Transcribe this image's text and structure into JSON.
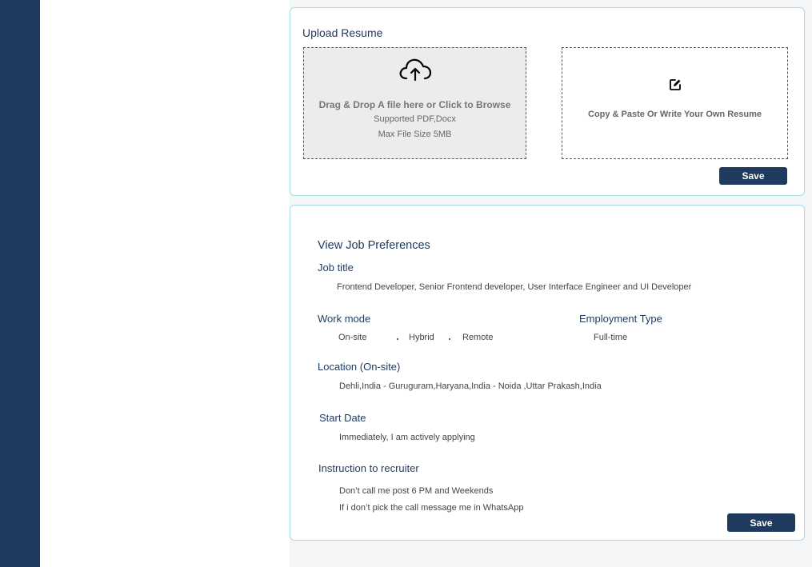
{
  "upload_resume": {
    "title": "Upload Resume",
    "dropzone": {
      "icon": "cloud-upload-icon",
      "main_text": "Drag & Drop A file here or Click to Browse",
      "supported_text": "Supported PDF,Docx",
      "max_size_text": "Max File Size 5MB"
    },
    "write_box": {
      "icon": "edit-icon",
      "text": "Copy & Paste Or Write Your Own Resume"
    },
    "save_label": "Save"
  },
  "job_preferences": {
    "title": "View Job Preferences",
    "job_title": {
      "label": "Job title",
      "value": "Frontend Developer, Senior Frontend developer, User Interface Engineer and UI Developer"
    },
    "work_mode": {
      "label": "Work mode",
      "options": [
        "On-site",
        "Hybrid",
        "Remote"
      ]
    },
    "employment_type": {
      "label": "Employment Type",
      "value": "Full-time"
    },
    "location": {
      "label": "Location (On-site)",
      "value": "Dehli,India - Guruguram,Haryana,India - Noida ,Uttar Prakash,India"
    },
    "start_date": {
      "label": "Start Date",
      "value": "Immediately, I am actively applying"
    },
    "instruction": {
      "label": "Instruction to recruiter",
      "line1": "Don’t call me post 6 PM and Weekends",
      "line2": "If i don’t pick the call message me in  WhatsApp"
    },
    "save_label": "Save"
  },
  "colors": {
    "sidebar": "#1f3a5f",
    "accent": "#1f3a5f",
    "card_border": "#a9dbe6"
  }
}
